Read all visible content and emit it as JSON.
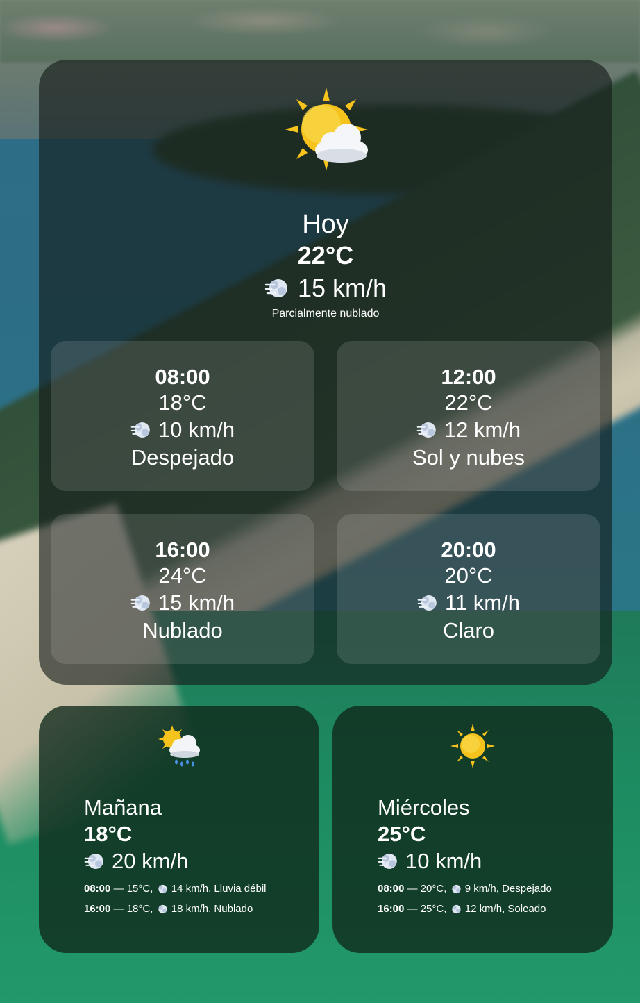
{
  "today": {
    "icon": "sun-behind-cloud-icon",
    "label": "Hoy",
    "temp": "22°C",
    "wind": "15 km/h",
    "description": "Parcialmente nublado",
    "hours": [
      {
        "time": "08:00",
        "temp": "18°C",
        "wind": "10 km/h",
        "desc": "Despejado"
      },
      {
        "time": "12:00",
        "temp": "22°C",
        "wind": "12 km/h",
        "desc": "Sol y nubes"
      },
      {
        "time": "16:00",
        "temp": "24°C",
        "wind": "15 km/h",
        "desc": "Nublado"
      },
      {
        "time": "20:00",
        "temp": "20°C",
        "wind": "11 km/h",
        "desc": "Claro"
      }
    ]
  },
  "forecast": [
    {
      "icon": "sun-behind-rain-cloud-icon",
      "name": "Mañana",
      "temp": "18°C",
      "wind": "20 km/h",
      "details": [
        {
          "time": "08:00",
          "text": " — 15°C, ",
          "wind": "14 km/h, Lluvia débil"
        },
        {
          "time": "16:00",
          "text": " — 18°C, ",
          "wind": "18 km/h, Nublado"
        }
      ]
    },
    {
      "icon": "sun-icon",
      "name": "Miércoles",
      "temp": "25°C",
      "wind": "10 km/h",
      "details": [
        {
          "time": "08:00",
          "text": " — 20°C, ",
          "wind": "9 km/h, Despejado"
        },
        {
          "time": "16:00",
          "text": " — 25°C, ",
          "wind": "12 km/h, Soleado"
        }
      ]
    }
  ],
  "colors": {
    "sun": "#f6c21c",
    "cloud": "#f2f4f7",
    "wind": "#c9d7ea"
  }
}
